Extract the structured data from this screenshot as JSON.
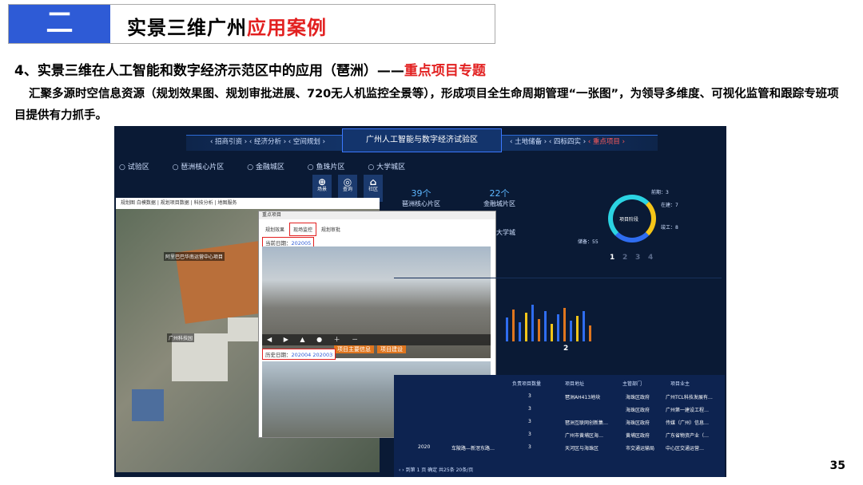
{
  "header": {
    "number": "二",
    "title_black": "实景三维广州",
    "title_red": "应用案例"
  },
  "section": {
    "title_black": "4、实景三维在人工智能和数字经济示范区中的应用（琶洲）——",
    "title_red": "重点项目专题"
  },
  "paragraph": "汇聚多源时空信息资源（规划效果图、规划审批进展、720无人机监控全景等），形成项目全生命周期管理“一张图”，为领导多维度、可视化监管和跟踪专班项目提供有力抓手。",
  "page_number": "35",
  "dashboard": {
    "nav_left": "‹ 招商引资 › ‹ 经济分析 › ‹ 空间规划 ›",
    "nav_center": "广州人工智能与数字经济试验区",
    "nav_right_a": "‹ 土地储备 › ‹ 四标四实 ›",
    "nav_right_b": "‹ 重点项目 ›",
    "radios": [
      "○ 试验区",
      "○ 琶洲核心片区",
      "○ 金融城区",
      "○ 鱼珠片区",
      "○ 大学城区"
    ],
    "tools": [
      "场景",
      "查询",
      "社区"
    ],
    "stats": [
      {
        "value": "39个",
        "label": "琶洲核心片区"
      },
      {
        "value": "22个",
        "label": "金融城片区"
      }
    ],
    "misc_label": "大学城",
    "map_toolbar": "规划图  白模数据 | 规划项目数据 | 科技分析 | 地图服务",
    "map_labels": [
      "阿里巴巴华南运营中心项目",
      "广州科技园"
    ],
    "popup": {
      "title": "重点项目",
      "tabs": [
        "规划效果",
        "现场监控",
        "规划审批"
      ],
      "current_label": "当前日期：",
      "current_date": "202005",
      "history_label": "历史日期：",
      "history_dates": [
        "202004",
        "202003"
      ],
      "toolbar_icons": "◀ ▶ ▲ ● ＋ －",
      "badges": [
        "项目主要信息",
        "项目建设"
      ]
    },
    "ring": {
      "center": "项目阶段",
      "notes": [
        "前期：3",
        "在建：7",
        "竣工：8",
        "储备：55"
      ]
    },
    "pages_a": [
      "1",
      "2",
      "3",
      "4"
    ],
    "page_b": "2",
    "table": {
      "headers": [
        "负责项目数量",
        "项目地址",
        "主管部门",
        "项目业主"
      ],
      "rows": [
        [
          "3",
          "琶洲AH413地块",
          "海珠区政府",
          "广州TCL科技发展有…"
        ],
        [
          "3",
          "",
          "海珠区政府",
          "广州第一建设工程…"
        ],
        [
          "3",
          "琶洲互联网创新集…",
          "海珠区政府",
          "传媒（广州）信息…"
        ],
        [
          "3",
          "广州市黄埔区海…",
          "黄埔区政府",
          "广东省物资产业（…"
        ],
        [
          "3",
          "天河区与海珠区",
          "市交通运输局",
          "中心区交通运营…"
        ]
      ],
      "last_row_year": "2020",
      "last_row_name": "车陂路—新滘东路…",
      "pager": "‹  ›  到第  1  页  确定  共25条  20条/页"
    }
  }
}
